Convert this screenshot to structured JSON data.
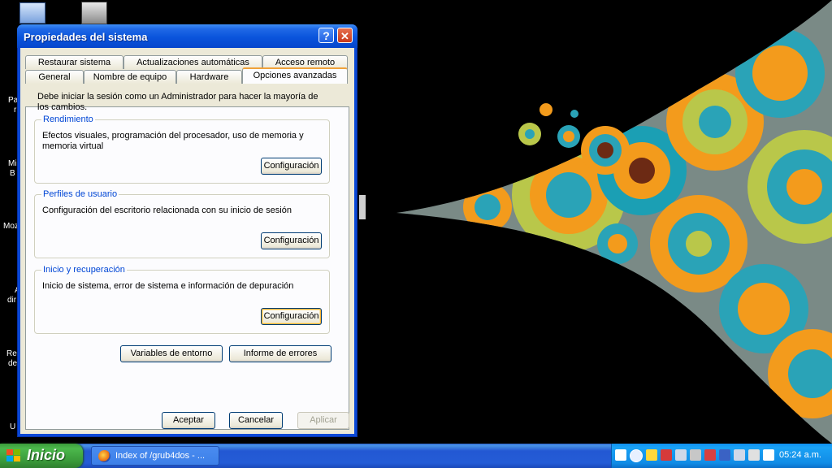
{
  "desktop": {
    "icon_labels": [
      "Pa",
      "r",
      "Mi",
      "B",
      "Moz",
      "A",
      "dir",
      "Re",
      "de",
      "U"
    ]
  },
  "dialog": {
    "title": "Propiedades del sistema",
    "help_glyph": "?",
    "close_glyph": "✕",
    "tabs_row1": [
      "Restaurar sistema",
      "Actualizaciones automáticas",
      "Acceso remoto"
    ],
    "tabs_row2": [
      "General",
      "Nombre de equipo",
      "Hardware",
      "Opciones avanzadas"
    ],
    "active_tab": "Opciones avanzadas",
    "intro_text": "Debe iniciar la sesión como un Administrador para hacer la mayoría de los cambios.",
    "groups": [
      {
        "label": "Rendimiento",
        "text": "Efectos visuales, programación del procesador, uso de memoria y memoria virtual",
        "button": "Configuración"
      },
      {
        "label": "Perfiles de usuario",
        "text": "Configuración del escritorio relacionada con su inicio de sesión",
        "button": "Configuración"
      },
      {
        "label": "Inicio y recuperación",
        "text": "Inicio de sistema, error de sistema e información de depuración",
        "button": "Configuración"
      }
    ],
    "env_button": "Variables de entorno",
    "errors_button": "Informe de errores",
    "ok_button": "Aceptar",
    "cancel_button": "Cancelar",
    "apply_button": "Aplicar"
  },
  "taskbar": {
    "start_label": "Inicio",
    "task_label": "Index of /grub4dos - ...",
    "clock": "05:24 a.m."
  },
  "colors": {
    "titlebar": "#0a54dc",
    "taskbar": "#245cd6",
    "start": "#3a9a3a",
    "tray": "#118ce6",
    "group_label": "#0046d5",
    "tab_highlight": "#f0a23a"
  }
}
